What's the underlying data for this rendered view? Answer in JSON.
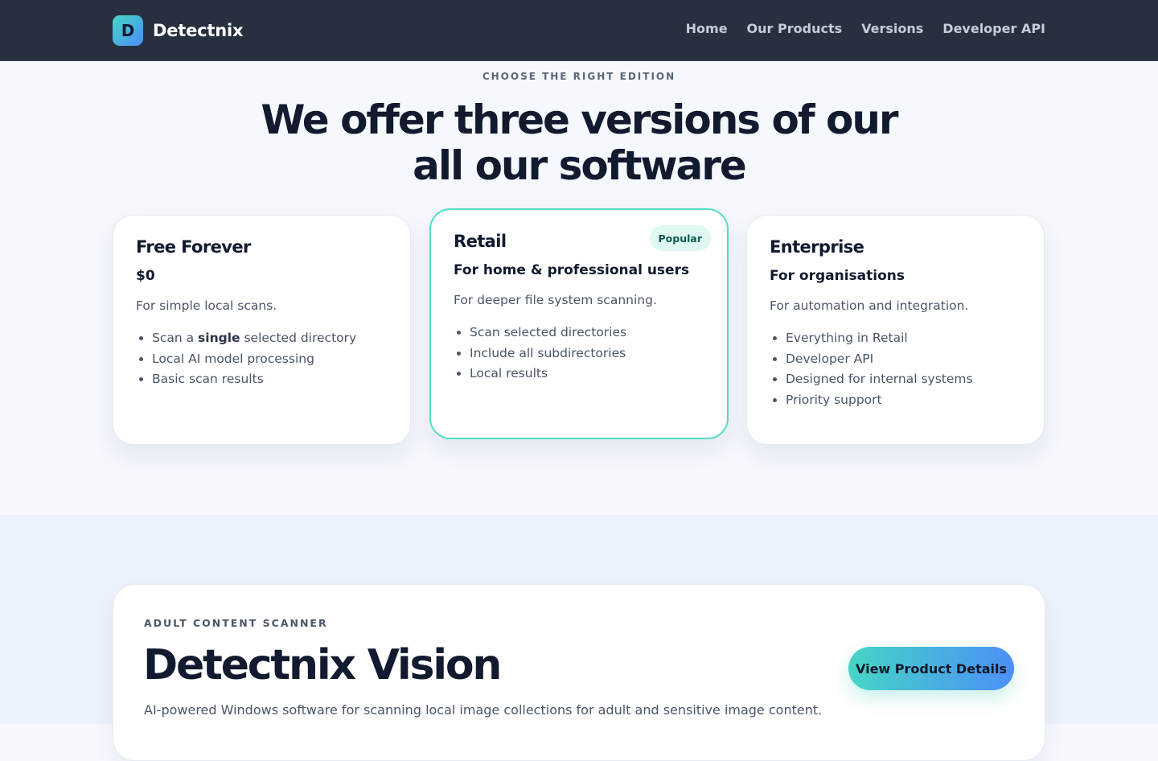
{
  "header": {
    "logo_letter": "D",
    "brand_name": "Detectnix",
    "nav": [
      "Home",
      "Our Products",
      "Versions",
      "Developer API"
    ]
  },
  "pricing": {
    "eyebrow": "CHOOSE THE RIGHT EDITION",
    "headline_line1": "We offer three versions of our",
    "headline_line2": "all our software",
    "plans": [
      {
        "title": "Free Forever",
        "subtitle": "$0",
        "description": "For simple local scans.",
        "features": [
          {
            "pre": "Scan a ",
            "bold": "single",
            "post": " selected directory"
          },
          {
            "text": "Local AI model processing"
          },
          {
            "text": "Basic scan results"
          }
        ]
      },
      {
        "title": "Retail",
        "badge": "Popular",
        "subtitle": "For home & professional users",
        "description": "For deeper file system scanning.",
        "features": [
          {
            "text": "Scan selected directories"
          },
          {
            "text": "Include all subdirectories"
          },
          {
            "text": "Local results"
          }
        ]
      },
      {
        "title": "Enterprise",
        "subtitle": "For organisations",
        "description": "For automation and integration.",
        "features": [
          {
            "text": "Everything in Retail"
          },
          {
            "text": "Developer API"
          },
          {
            "text": "Designed for internal systems"
          },
          {
            "text": "Priority support"
          }
        ]
      }
    ]
  },
  "product": {
    "eyebrow": "ADULT CONTENT SCANNER",
    "title": "Detectnix Vision",
    "description": "AI-powered Windows software for scanning local image collections for adult and sensitive image content.",
    "cta_label": "View Product Details"
  },
  "colors": {
    "header_bg": "#27303e",
    "accent_teal": "#45d6c5",
    "accent_blue": "#4b8ff6",
    "featured_border": "#54dcc5"
  }
}
